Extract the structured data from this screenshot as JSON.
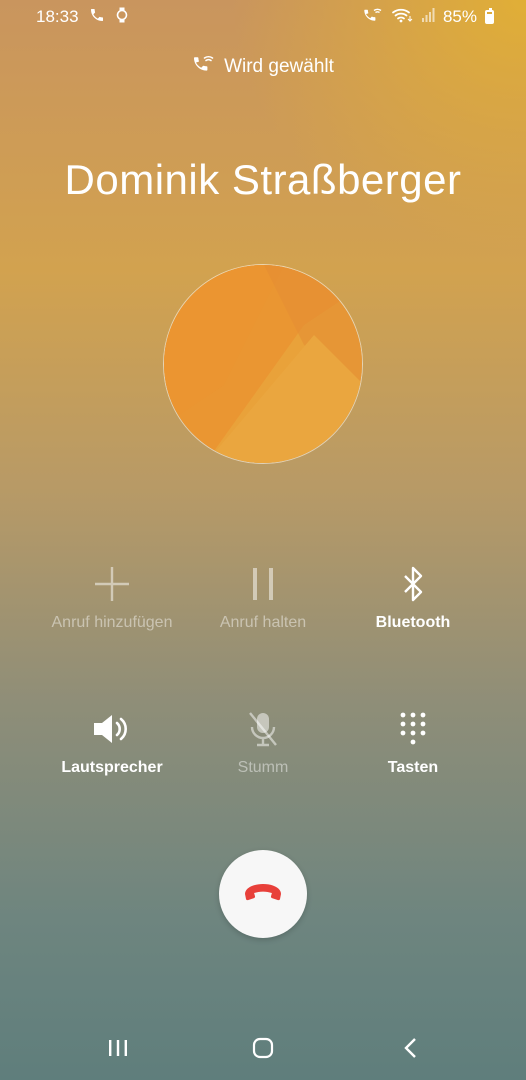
{
  "status_bar": {
    "time": "18:33",
    "battery": "85%",
    "left_icons": [
      "phone-icon",
      "watch-icon"
    ],
    "right_icons": [
      "wifi-call-icon",
      "wifi-icon",
      "signal-icon",
      "battery-icon"
    ]
  },
  "call": {
    "status": "Wird gewählt",
    "caller_name": "Dominik Straßberger"
  },
  "controls": [
    {
      "label": "Anruf hinzufügen",
      "icon": "plus-icon",
      "enabled": false
    },
    {
      "label": "Anruf halten",
      "icon": "pause-icon",
      "enabled": false
    },
    {
      "label": "Bluetooth",
      "icon": "bluetooth-icon",
      "enabled": true
    },
    {
      "label": "Lautsprecher",
      "icon": "speaker-icon",
      "enabled": true
    },
    {
      "label": "Stumm",
      "icon": "mic-off-icon",
      "enabled": false
    },
    {
      "label": "Tasten",
      "icon": "keypad-icon",
      "enabled": true
    }
  ],
  "end_call": {
    "icon": "end-call-icon",
    "color": "#e8403a"
  },
  "nav_bar": {
    "icons": [
      "recent-apps-icon",
      "home-icon",
      "back-icon"
    ]
  },
  "colors": {
    "avatar": "#e9a23a",
    "end_call_bg": "#f7f7f7"
  }
}
